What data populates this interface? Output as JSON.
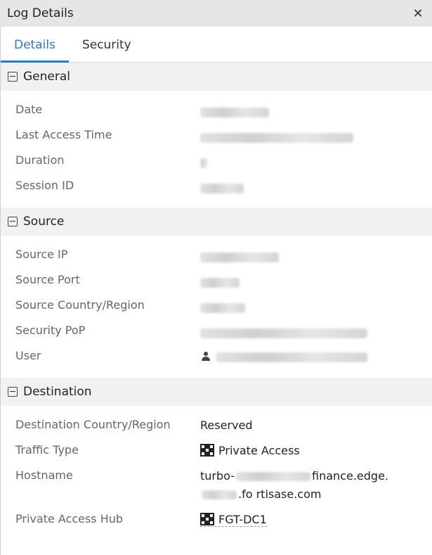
{
  "window": {
    "title": "Log Details",
    "close_icon": "close-icon"
  },
  "tabs": [
    {
      "label": "Details",
      "active": true
    },
    {
      "label": "Security",
      "active": false
    }
  ],
  "sections": {
    "general": {
      "title": "General",
      "rows": [
        {
          "label": "Date"
        },
        {
          "label": "Last Access Time"
        },
        {
          "label": "Duration"
        },
        {
          "label": "Session ID"
        }
      ]
    },
    "source": {
      "title": "Source",
      "rows": [
        {
          "label": "Source IP"
        },
        {
          "label": "Source Port"
        },
        {
          "label": "Source Country/Region"
        },
        {
          "label": "Security PoP"
        },
        {
          "label": "User"
        }
      ]
    },
    "destination": {
      "title": "Destination",
      "rows": [
        {
          "label": "Destination Country/Region",
          "value": "Reserved"
        },
        {
          "label": "Traffic Type",
          "value": "Private Access"
        },
        {
          "label": "Hostname",
          "value_part1": "turbo-",
          "value_part2": "finance.edge.",
          "value_part3": ".fo rtisase.com"
        },
        {
          "label": "Private Access Hub",
          "value": "FGT-DC1"
        }
      ]
    }
  },
  "colors": {
    "accent": "#2f79c2",
    "header_bg": "#e6e6e6",
    "section_bg": "#f1f1f1"
  }
}
